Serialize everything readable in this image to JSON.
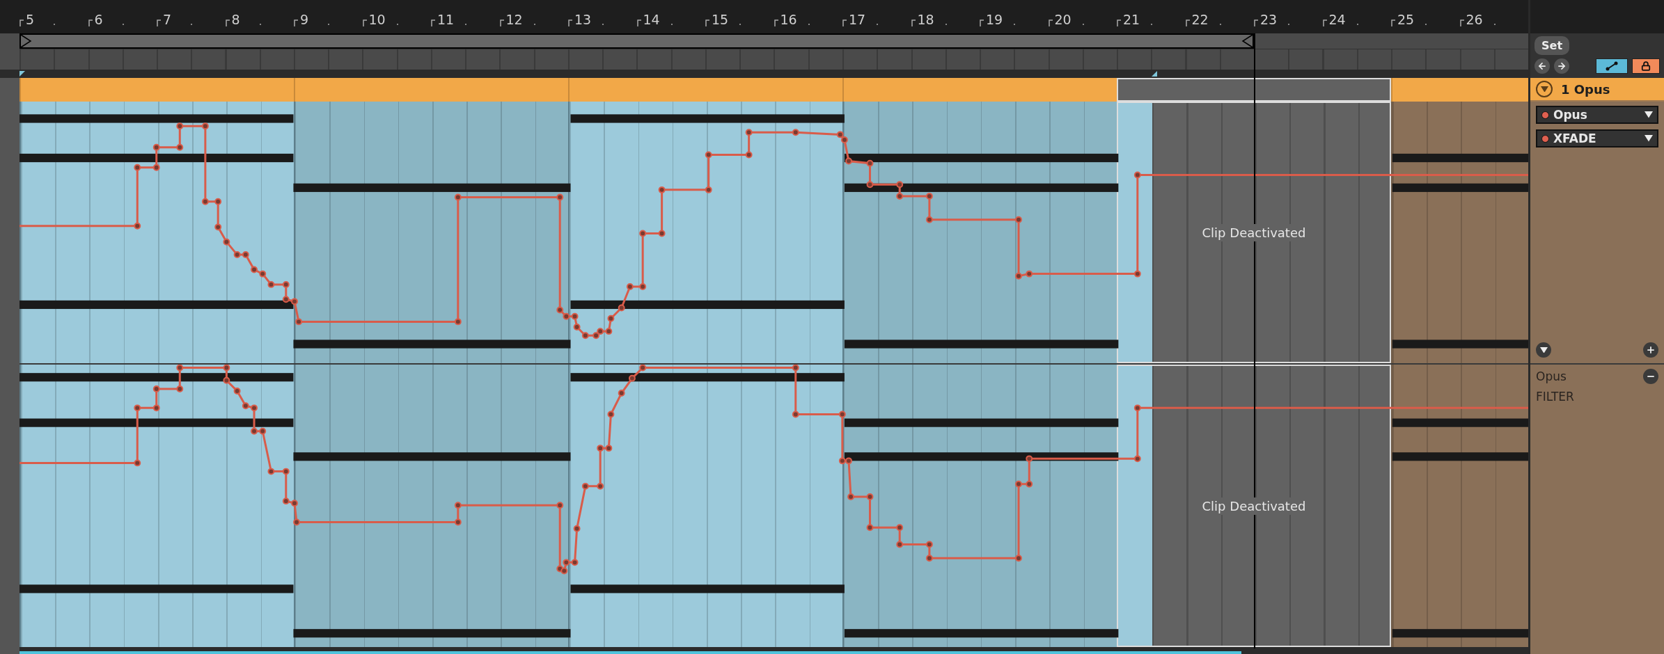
{
  "ruler": {
    "bars": [
      "5",
      "6",
      "7",
      "8",
      "9",
      "10",
      "11",
      "12",
      "13",
      "14",
      "15",
      "16",
      "17",
      "18",
      "19",
      "20",
      "21",
      "22",
      "23",
      "24",
      "25",
      "26"
    ]
  },
  "controls": {
    "set_label": "Set",
    "automation_mode": {
      "on": true
    },
    "lock": {
      "on": true
    }
  },
  "track": {
    "name": "1 Opus",
    "clips": [
      {
        "kind": "active",
        "color": "#9ccadb"
      },
      {
        "kind": "active",
        "color": "#8ab5c3"
      },
      {
        "kind": "active",
        "color": "#9ccadb"
      },
      {
        "kind": "active",
        "color": "#8ab5c3"
      },
      {
        "kind": "deactivated",
        "color": "#9ccadb",
        "lane_texts": [
          "Clip Deactivated",
          "Clip Deactivated"
        ]
      },
      {
        "kind": "empty",
        "color": "#8a7058"
      }
    ],
    "lanes": [
      {
        "kind": "chooser",
        "device": "Opus",
        "parameter": "XFADE"
      },
      {
        "kind": "label",
        "device": "Opus",
        "parameter": "FILTER"
      }
    ]
  }
}
